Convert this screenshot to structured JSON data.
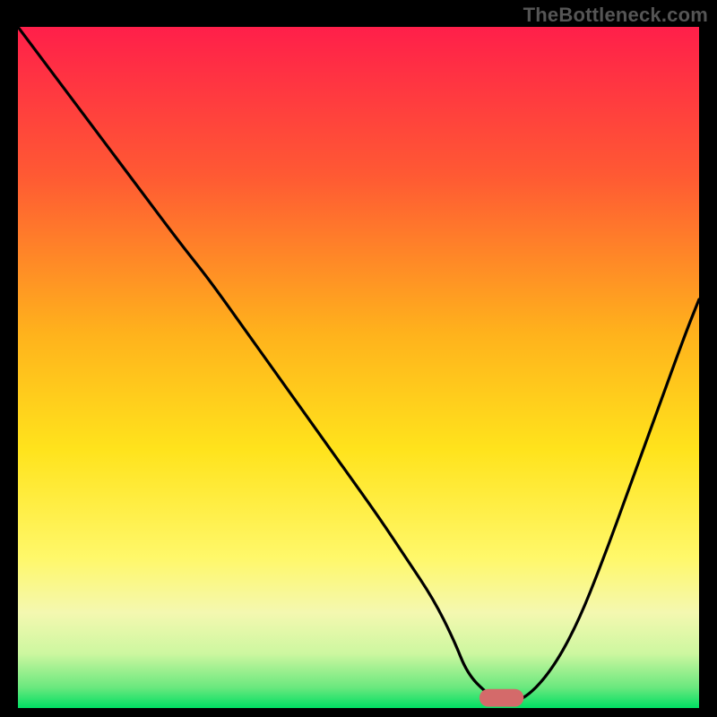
{
  "watermark": "TheBottleneck.com",
  "colors": {
    "gradient_top": "#ff1f4a",
    "gradient_mid_top": "#ff7a2a",
    "gradient_mid": "#ffd21c",
    "gradient_mid_low": "#f7f585",
    "gradient_low": "#d8f7a4",
    "gradient_bottom": "#00e064",
    "curve": "#000000",
    "marker_fill": "#d46a6a",
    "background": "#000000"
  },
  "chart_data": {
    "type": "line",
    "title": "",
    "xlabel": "",
    "ylabel": "",
    "xlim": [
      0,
      100
    ],
    "ylim": [
      0,
      100
    ],
    "grid": false,
    "series": [
      {
        "name": "bottleneck-curve",
        "x": [
          0,
          6,
          12,
          18,
          24,
          28,
          33,
          38,
          43,
          48,
          53,
          57,
          61,
          64,
          66,
          69,
          71,
          74,
          78,
          82,
          86,
          90,
          94,
          98,
          100
        ],
        "y": [
          100,
          92,
          84,
          76,
          68,
          63,
          56,
          49,
          42,
          35,
          28,
          22,
          16,
          10,
          5,
          2,
          1,
          1,
          5,
          12,
          22,
          33,
          44,
          55,
          60
        ]
      }
    ],
    "annotations": [
      {
        "name": "min-marker",
        "shape": "rounded-rect",
        "x_center": 71,
        "y_center": 1.5,
        "width_pct": 6.5,
        "height_pct": 2.6,
        "fill": "#d46a6a"
      }
    ],
    "notes": "x and y are in percent of plot area; y increases upward. Values are estimated from pixels."
  }
}
